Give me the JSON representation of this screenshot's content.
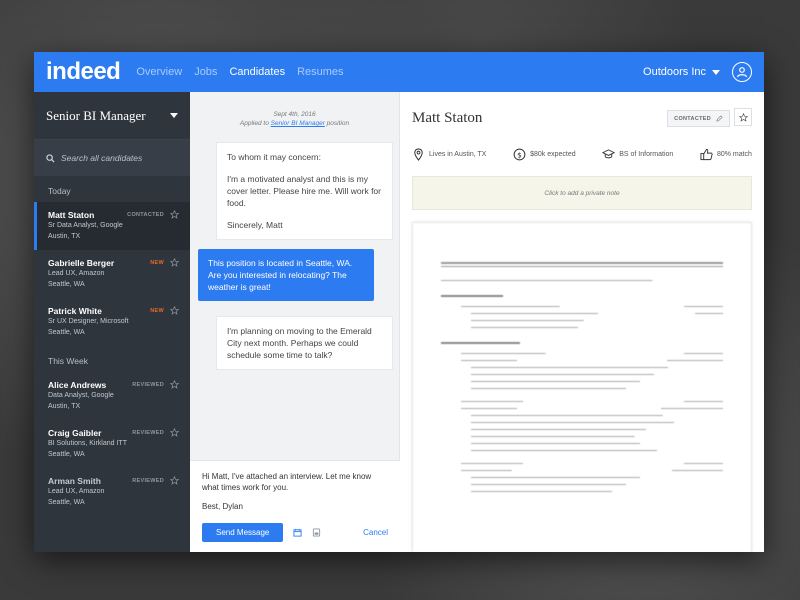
{
  "nav": {
    "logo": "indeed",
    "links": [
      "Overview",
      "Jobs",
      "Candidates",
      "Resumes"
    ],
    "active_index": 2,
    "company": "Outdoors Inc"
  },
  "sidebar": {
    "job_title": "Senior BI Manager",
    "search_placeholder": "Search all candidates",
    "sections": [
      {
        "label": "Today",
        "candidates": [
          {
            "name": "Matt Staton",
            "line1": "Sr Data Analyst, Google",
            "line2": "Austin, TX",
            "badge": "CONTACTED",
            "selected": true
          },
          {
            "name": "Gabrielle Berger",
            "line1": "Lead UX, Amazon",
            "line2": "Seattle, WA",
            "badge": "NEW"
          },
          {
            "name": "Patrick White",
            "line1": "Sr UX Designer, Microsoft",
            "line2": "Seattle, WA",
            "badge": "NEW"
          }
        ]
      },
      {
        "label": "This Week",
        "candidates": [
          {
            "name": "Alice Andrews",
            "line1": "Data Analyst, Google",
            "line2": "Austin, TX",
            "badge": "REVIEWED"
          },
          {
            "name": "Craig Gaibler",
            "line1": "BI Solutions, Kirkland ITT",
            "line2": "Seattle, WA",
            "badge": "REVIEWED"
          },
          {
            "name": "Arman Smith",
            "line1": "Lead UX, Amazon",
            "line2": "Seattle, WA",
            "badge": "REVIEWED"
          }
        ]
      }
    ]
  },
  "conversation": {
    "date": "Sept 4th, 2016",
    "applied_prefix": "Applied to",
    "applied_job": "Senior BI Manager",
    "applied_suffix": "position",
    "messages": [
      {
        "from": "candidate",
        "paragraphs": [
          "To whom it may concern:",
          "I'm a motivated analyst and this is my cover letter. Please hire me.  Will work for food.",
          "Sincerely, Matt"
        ]
      },
      {
        "from": "recruiter",
        "paragraphs": [
          "This position is located in Seattle, WA.  Are you interested in relocating?  The weather is great!"
        ]
      },
      {
        "from": "candidate",
        "paragraphs": [
          "I'm planning on moving to the Emerald City next month.  Perhaps we could schedule some time to talk?"
        ]
      }
    ],
    "composer": {
      "line1": "Hi Matt, I've attached an interview. Let me know what times work for you.",
      "line2": "Best, Dylan",
      "send_label": "Send Message",
      "cancel_label": "Cancel"
    }
  },
  "detail": {
    "name": "Matt Staton",
    "status_label": "CONTACTED",
    "facts": [
      {
        "icon": "location-pin-icon",
        "text": "Lives in Austin, TX"
      },
      {
        "icon": "dollar-icon",
        "text": "$80k expected"
      },
      {
        "icon": "graduation-cap-icon",
        "text": "BS of Information"
      },
      {
        "icon": "thumbs-up-icon",
        "text": "80% match"
      }
    ],
    "note_placeholder": "Click to add a private note"
  },
  "colors": {
    "brand_blue": "#2d7bf0",
    "sidebar_bg": "#2f353d",
    "new_badge": "#e46a2b"
  }
}
